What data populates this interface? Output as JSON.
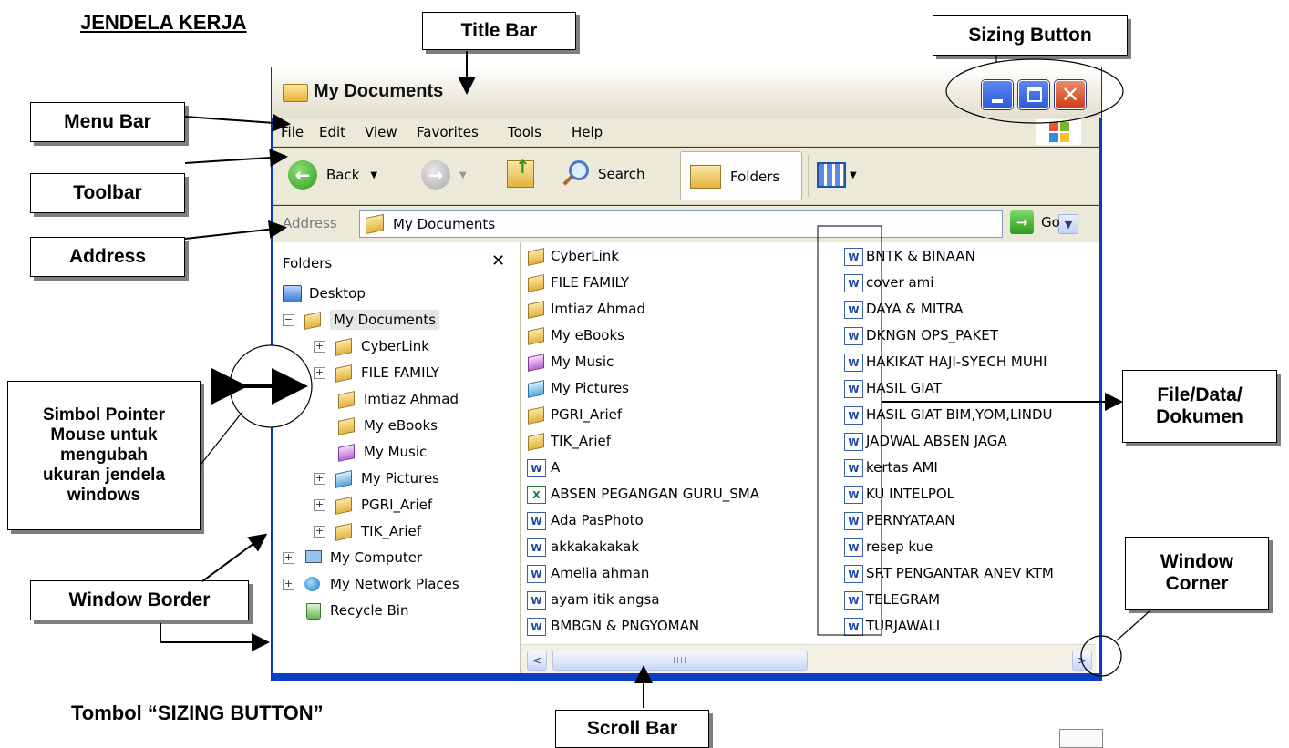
{
  "heading": "JENDELA KERJA",
  "caption": "Tombol “SIZING BUTTON”",
  "labels": {
    "title_bar": "Title Bar",
    "sizing_button": "Sizing Button",
    "menu_bar": "Menu Bar",
    "toolbar": "Toolbar",
    "address": "Address",
    "pointer_line1": "Simbol Pointer",
    "pointer_line2": "Mouse untuk",
    "pointer_line3": "mengubah",
    "pointer_line4": "ukuran jendela",
    "pointer_line5": "windows",
    "file_data_line1": "File/Data/",
    "file_data_line2": "Dokumen",
    "window_corner_line1": "Window",
    "window_corner_line2": "Corner",
    "window_border": "Window Border",
    "scroll_bar": "Scroll Bar"
  },
  "window": {
    "title": "My Documents",
    "close_glyph": "✕"
  },
  "menu": [
    "File",
    "Edit",
    "View",
    "Favorites",
    "Tools",
    "Help"
  ],
  "toolbar": {
    "back": "Back",
    "search": "Search",
    "folders": "Folders"
  },
  "address": {
    "label": "Address",
    "value": "My Documents",
    "go": "Go"
  },
  "folders_pane": {
    "title": "Folders",
    "close": "✕",
    "tree": [
      {
        "label": "Desktop",
        "icon": "desktop-icon",
        "expander": ""
      },
      {
        "label": "My Documents",
        "icon": "my-documents-icon",
        "expander": "−"
      },
      {
        "label": "CyberLink",
        "icon": "folder-icon",
        "expander": "+"
      },
      {
        "label": "FILE FAMILY",
        "icon": "folder-icon",
        "expander": "+"
      },
      {
        "label": "Imtiaz Ahmad",
        "icon": "folder-icon",
        "expander": ""
      },
      {
        "label": "My eBooks",
        "icon": "folder-icon",
        "expander": ""
      },
      {
        "label": "My Music",
        "icon": "music-folder-icon",
        "expander": ""
      },
      {
        "label": "My Pictures",
        "icon": "pictures-folder-icon",
        "expander": "+"
      },
      {
        "label": "PGRI_Arief",
        "icon": "folder-icon",
        "expander": "+"
      },
      {
        "label": "TIK_Arief",
        "icon": "folder-icon",
        "expander": "+"
      },
      {
        "label": "My Computer",
        "icon": "computer-icon",
        "expander": "+"
      },
      {
        "label": "My Network Places",
        "icon": "network-icon",
        "expander": "+"
      },
      {
        "label": "Recycle Bin",
        "icon": "recycle-bin-icon",
        "expander": ""
      }
    ]
  },
  "files_col1": [
    {
      "name": "CyberLink",
      "icon": "folder"
    },
    {
      "name": "FILE FAMILY",
      "icon": "folder"
    },
    {
      "name": "Imtiaz Ahmad",
      "icon": "folder"
    },
    {
      "name": "My eBooks",
      "icon": "folder"
    },
    {
      "name": "My Music",
      "icon": "music"
    },
    {
      "name": "My Pictures",
      "icon": "pics"
    },
    {
      "name": "PGRI_Arief",
      "icon": "folder"
    },
    {
      "name": "TIK_Arief",
      "icon": "folder"
    },
    {
      "name": "A",
      "icon": "doc"
    },
    {
      "name": "ABSEN PEGANGAN GURU_SMA",
      "icon": "xls"
    },
    {
      "name": "Ada PasPhoto",
      "icon": "doc"
    },
    {
      "name": "akkakakakak",
      "icon": "doc"
    },
    {
      "name": "Amelia ahman",
      "icon": "doc"
    },
    {
      "name": "ayam itik angsa",
      "icon": "doc"
    },
    {
      "name": "BMBGN & PNGYOMAN",
      "icon": "doc"
    }
  ],
  "files_col2": [
    "BNTK & BINAAN",
    "cover ami",
    "DAYA & MITRA",
    "DKNGN OPS_PAKET",
    "HAKIKAT HAJI-SYECH MUHI",
    "HASIL GIAT",
    "HASIL GIAT BIM,YOM,LINDU",
    "JADWAL ABSEN JAGA",
    "kertas AMI",
    "KU INTELPOL",
    "PERNYATAAN",
    "resep kue",
    "SRT PENGANTAR ANEV KTM",
    "TELEGRAM",
    "TURJAWALI"
  ],
  "scrollbar": {
    "left": "<",
    "right": ">",
    "grip": "IIII"
  },
  "colors": {
    "xp_blue": "#0a3fc4",
    "chrome": "#ece9d8",
    "close_red": "#cf3a14"
  }
}
